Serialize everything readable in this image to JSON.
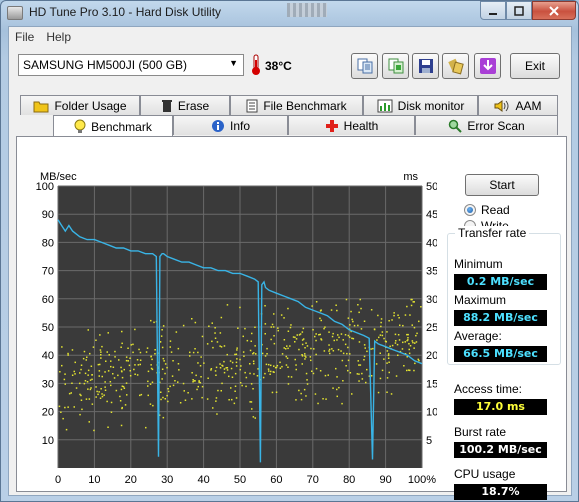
{
  "window": {
    "title": "HD Tune Pro 3.10 - Hard Disk Utility"
  },
  "menu": {
    "file": "File",
    "help": "Help"
  },
  "toolbar": {
    "drive": "SAMSUNG HM500JI (500 GB)",
    "temperature": "38°C",
    "exit_label": "Exit",
    "icons": [
      "copy-info-icon",
      "copy-screen-icon",
      "save-icon",
      "options-icon",
      "down-arrow-icon"
    ]
  },
  "tabs_top": [
    "Folder Usage",
    "Erase",
    "File Benchmark",
    "Disk monitor",
    "AAM"
  ],
  "tabs_bottom": [
    "Benchmark",
    "Info",
    "Health",
    "Error Scan"
  ],
  "active_tab": "Benchmark",
  "controls": {
    "start_label": "Start",
    "read_label": "Read",
    "write_label": "Write",
    "selected_mode": "Read"
  },
  "transfer_rate": {
    "title": "Transfer rate",
    "minimum_label": "Minimum",
    "minimum_value": "0.2 MB/sec",
    "maximum_label": "Maximum",
    "maximum_value": "88.2 MB/sec",
    "average_label": "Average:",
    "average_value": "66.5 MB/sec"
  },
  "stats": {
    "access_time_label": "Access time:",
    "access_time_value": "17.0 ms",
    "burst_rate_label": "Burst rate",
    "burst_rate_value": "100.2 MB/sec",
    "cpu_usage_label": "CPU usage",
    "cpu_usage_value": "18.7%"
  },
  "colors": {
    "plot_background": "#3a3a3a",
    "grid": "#6a6a6a",
    "transfer_line": "#39b4e6",
    "access_points": "#e4e430"
  },
  "chart_data": {
    "type": "line",
    "left_axis_unit": "MB/sec",
    "right_axis_unit": "ms",
    "x_ticks": [
      "0",
      "10",
      "20",
      "30",
      "40",
      "50",
      "60",
      "70",
      "80",
      "90",
      "100%"
    ],
    "y_left_ticks": [
      "10",
      "20",
      "30",
      "40",
      "50",
      "60",
      "70",
      "80",
      "90",
      "100"
    ],
    "y_right_ticks": [
      "5",
      "10",
      "15",
      "20",
      "25",
      "30",
      "35",
      "40",
      "45",
      "50"
    ],
    "xlim": [
      0,
      100
    ],
    "ylim_left": [
      0,
      100
    ],
    "ylim_right": [
      0,
      50
    ],
    "grid": true,
    "series": [
      {
        "label": "transfer-rate",
        "axis": "left",
        "x": [
          0,
          1,
          2,
          3,
          4,
          5,
          6,
          8,
          10,
          12,
          14,
          16,
          18,
          20,
          22,
          24,
          26,
          27,
          27.6,
          28,
          28.6,
          29,
          30,
          32,
          34,
          36,
          38,
          40,
          42,
          44,
          46,
          48,
          50,
          52,
          54,
          55,
          55.6,
          56,
          56.6,
          57,
          58,
          60,
          62,
          64,
          66,
          68,
          70,
          72,
          74,
          76,
          78,
          80,
          82,
          84,
          85.5,
          86.4,
          87,
          88,
          90,
          92,
          94,
          96,
          98,
          100
        ],
        "y": [
          88,
          86,
          84,
          86,
          84,
          83,
          82,
          81,
          81,
          80,
          79,
          78,
          78,
          77,
          77,
          76,
          76,
          75,
          4,
          75,
          76,
          76,
          75,
          74,
          73,
          73,
          72,
          71,
          71,
          70,
          70,
          69,
          69,
          68,
          67,
          66,
          2,
          65,
          66,
          64,
          63,
          62,
          61,
          60,
          59,
          57,
          56,
          55,
          54,
          52,
          51,
          49,
          48,
          47,
          46,
          3,
          45,
          44,
          43,
          42,
          41,
          40,
          38,
          37
        ]
      }
    ],
    "scatter": {
      "label": "access-time",
      "axis": "right",
      "x_range": [
        0,
        100
      ],
      "y_range_ms": [
        4,
        30
      ],
      "trend_ms_at_0": 15,
      "trend_ms_at_100": 23,
      "count": 650
    }
  }
}
